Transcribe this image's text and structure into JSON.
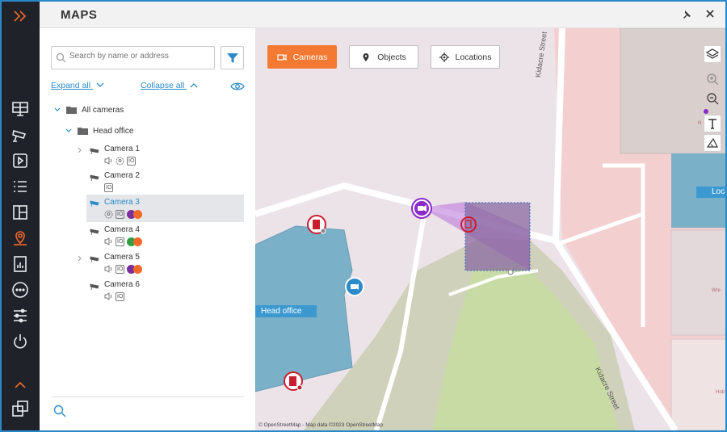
{
  "window": {
    "title": "MAPS"
  },
  "colors": {
    "accent": "#f47a33",
    "link": "#2b8bc9",
    "rail": "#1f2228",
    "building": "#7ab0c8",
    "selected_row": "#e4e6ea"
  },
  "rail": {
    "icons": [
      "chevron-double-right-icon",
      "monitor-grid-icon",
      "camera-icon",
      "play-icon",
      "list-icon",
      "layout-icon",
      "map-pin-icon",
      "report-icon",
      "more-icon",
      "sliders-icon",
      "power-icon",
      "chevron-up-icon",
      "windows-icon"
    ],
    "active": "map-pin-icon"
  },
  "panel": {
    "search_placeholder": "Search by name or address",
    "expand_all": "Expand all",
    "collapse_all": "Collapse all",
    "tree": {
      "root": "All cameras",
      "group": "Head office",
      "cameras": [
        {
          "name": "Camera 1",
          "badges": [
            "sound",
            "face",
            "io"
          ],
          "expandable": true,
          "selected": false
        },
        {
          "name": "Camera 2",
          "badges": [
            "io"
          ],
          "expandable": false,
          "selected": false
        },
        {
          "name": "Camera 3",
          "badges": [
            "face",
            "io",
            "dots"
          ],
          "expandable": false,
          "selected": true
        },
        {
          "name": "Camera 4",
          "badges": [
            "sound",
            "io",
            "dots"
          ],
          "expandable": false,
          "selected": false
        },
        {
          "name": "Camera 5",
          "badges": [
            "sound",
            "io",
            "dots"
          ],
          "expandable": true,
          "selected": false
        },
        {
          "name": "Camera 6",
          "badges": [
            "sound",
            "io"
          ],
          "expandable": false,
          "selected": false
        }
      ]
    }
  },
  "map": {
    "tabs": [
      {
        "label": "Cameras",
        "icon": "camera-outline-icon",
        "active": true
      },
      {
        "label": "Objects",
        "icon": "pin-icon",
        "active": false
      },
      {
        "label": "Locations",
        "icon": "target-icon",
        "active": false
      }
    ],
    "labels": {
      "street": "Kidacre Street",
      "building": "Head office",
      "location_cut": "Loca",
      "attribution": "© OpenStreetMap - Map data ©2023 OpenStreetMap",
      "tiny_1": "Wre",
      "tiny_2": "Hob",
      "tiny_3": "N"
    },
    "tools": [
      "layers-icon",
      "zoom-in-icon",
      "zoom-out-icon",
      "text-tool-icon",
      "measure-icon"
    ]
  }
}
